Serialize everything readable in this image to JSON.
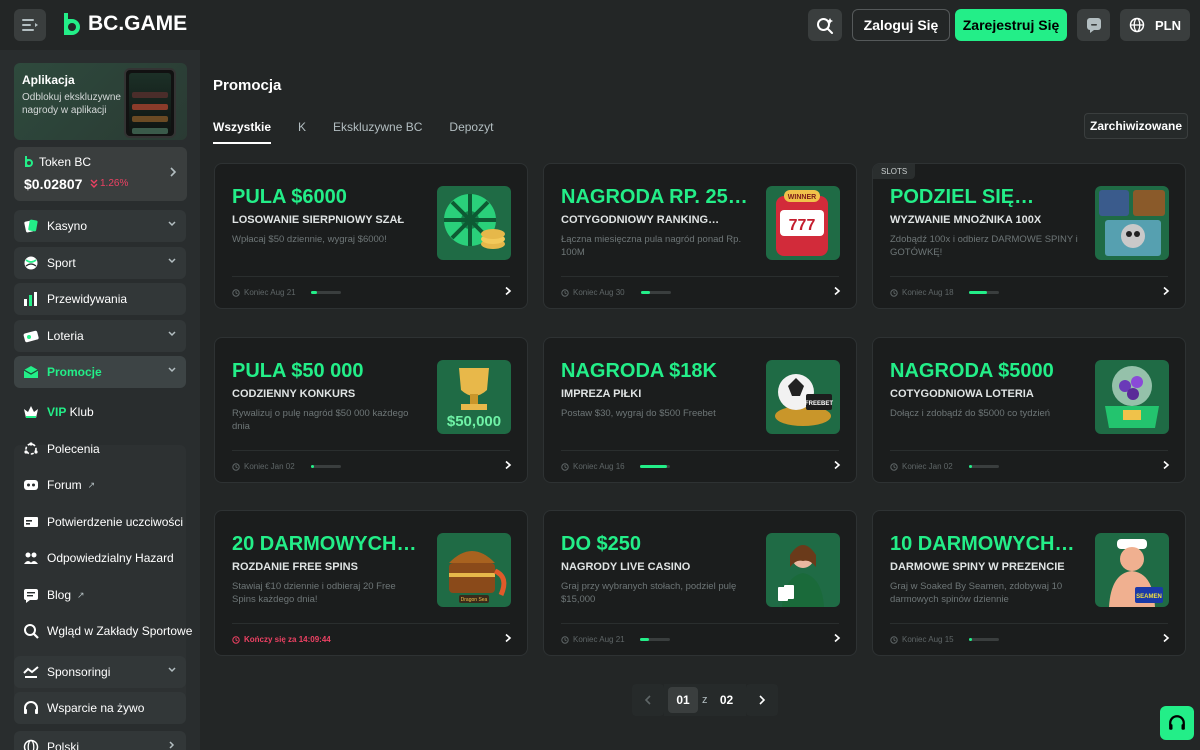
{
  "header": {
    "logo_text": "BC.GAME",
    "login_label": "Zaloguj Się",
    "register_label": "Zarejestruj Się",
    "currency": "PLN"
  },
  "sidebar": {
    "app_card": {
      "title": "Aplikacja",
      "subtitle": "Odblokuj ekskluzywne nagrody w aplikacji"
    },
    "token": {
      "name": "Token BC",
      "price": "$0.02807",
      "change": "1.26%"
    },
    "items": [
      {
        "label": "Kasyno",
        "icon": "casino-icon"
      },
      {
        "label": "Sport",
        "icon": "sport-icon"
      },
      {
        "label": "Przewidywania",
        "icon": "predictions-icon"
      },
      {
        "label": "Loteria",
        "icon": "lottery-icon"
      },
      {
        "label": "Promocje",
        "icon": "promotions-icon"
      },
      {
        "label_a": "VIP",
        "label_b": " Klub",
        "icon": "vip-icon"
      },
      {
        "label": "Polecenia",
        "icon": "referral-icon"
      },
      {
        "label": "Forum",
        "icon": "forum-icon"
      },
      {
        "label": "Potwierdzenie uczciwości",
        "icon": "fairness-icon"
      },
      {
        "label": "Odpowiedzialny Hazard",
        "icon": "responsible-icon"
      },
      {
        "label": "Blog",
        "icon": "blog-icon"
      },
      {
        "label": "Wgląd w Zakłady Sportowe",
        "icon": "insight-icon"
      },
      {
        "label": "Sponsoringi",
        "icon": "sponsor-icon"
      },
      {
        "label": "Wsparcie na żywo",
        "icon": "headset-icon"
      },
      {
        "label": "Polski",
        "icon": "globe-icon"
      }
    ]
  },
  "main": {
    "title": "Promocja",
    "tabs": [
      "Wszystkie",
      "K",
      "Ekskluzywne BC",
      "Depozyt"
    ],
    "archived_label": "Zarchiwizowane",
    "cards": [
      {
        "title": "PULA $6000",
        "subtitle": "LOSOWANIE SIERPNIOWY SZAŁ",
        "desc": "Wpłacaj $50 dziennie, wygraj $6000!",
        "end": "Koniec Aug 21",
        "progress": 0.2,
        "tag": ""
      },
      {
        "title": "NAGRODA RP. 25…",
        "subtitle": "COTYGODNIOWY RANKING…",
        "desc": "Łączna miesięczna pula nagród ponad Rp. 100M",
        "end": "Koniec Aug 30",
        "progress": 0.3,
        "tag": ""
      },
      {
        "title": "PODZIEL SIĘ…",
        "subtitle": "WYZWANIE MNOŻNIKA 100X",
        "desc": "Zdobądź 100x i odbierz DARMOWE SPINY i GOTÓWKĘ!",
        "end": "Koniec Aug 18",
        "progress": 0.6,
        "tag": "SLOTS"
      },
      {
        "title": "PULA $50 000",
        "subtitle": "CODZIENNY KONKURS",
        "desc": "Rywalizuj o pulę nagród $50 000 każdego dnia",
        "end": "Koniec Jan 02",
        "progress": 0.1,
        "tag": ""
      },
      {
        "title": "NAGRODA $18K",
        "subtitle": "IMPREZA PIŁKI",
        "desc": "Postaw $30, wygraj do $500 Freebet",
        "end": "Koniec Aug 16",
        "progress": 0.9,
        "tag": ""
      },
      {
        "title": "NAGRODA $5000",
        "subtitle": "COTYGODNIOWA LOTERIA",
        "desc": "Dołącz i zdobądź do $5000 co tydzień",
        "end": "Koniec Jan 02",
        "progress": 0.1,
        "tag": ""
      },
      {
        "title": "20 DARMOWYCH…",
        "subtitle": "ROZDANIE FREE SPINS",
        "desc": "Stawiaj €10 dziennie i odbieraj 20 Free Spins każdego dnia!",
        "end": "Kończy się za 14:09:44",
        "progress": null,
        "tag": ""
      },
      {
        "title": "DO $250",
        "subtitle": "NAGRODY LIVE CASINO",
        "desc": "Graj przy wybranych stołach, podziel pulę $15,000",
        "end": "Koniec Aug 21",
        "progress": 0.3,
        "tag": ""
      },
      {
        "title": "10 DARMOWYCH…",
        "subtitle": "DARMOWE SPINY W PREZENCIE",
        "desc": "Graj w Soaked By Seamen, zdobywaj 10 darmowych spinów dziennie",
        "end": "Koniec Aug 15",
        "progress": 0.1,
        "tag": ""
      }
    ],
    "images": {
      "0": {
        "text": ""
      },
      "1": {
        "text": "777",
        "badge": "WINNER"
      },
      "2": {
        "text": ""
      },
      "3": {
        "text": "$50,000"
      },
      "4": {
        "text": "FREEBET"
      },
      "5": {
        "text": ""
      },
      "6": {
        "text": "Dragon Sea"
      },
      "7": {
        "text": ""
      },
      "8": {
        "text": "SEAMEN"
      }
    },
    "pagination": {
      "current": "01",
      "of": "z",
      "total": "02"
    }
  },
  "colors": {
    "accent": "#23ee88",
    "bg": "#232626",
    "card": "#1b1d1d",
    "danger": "#ed4163"
  }
}
